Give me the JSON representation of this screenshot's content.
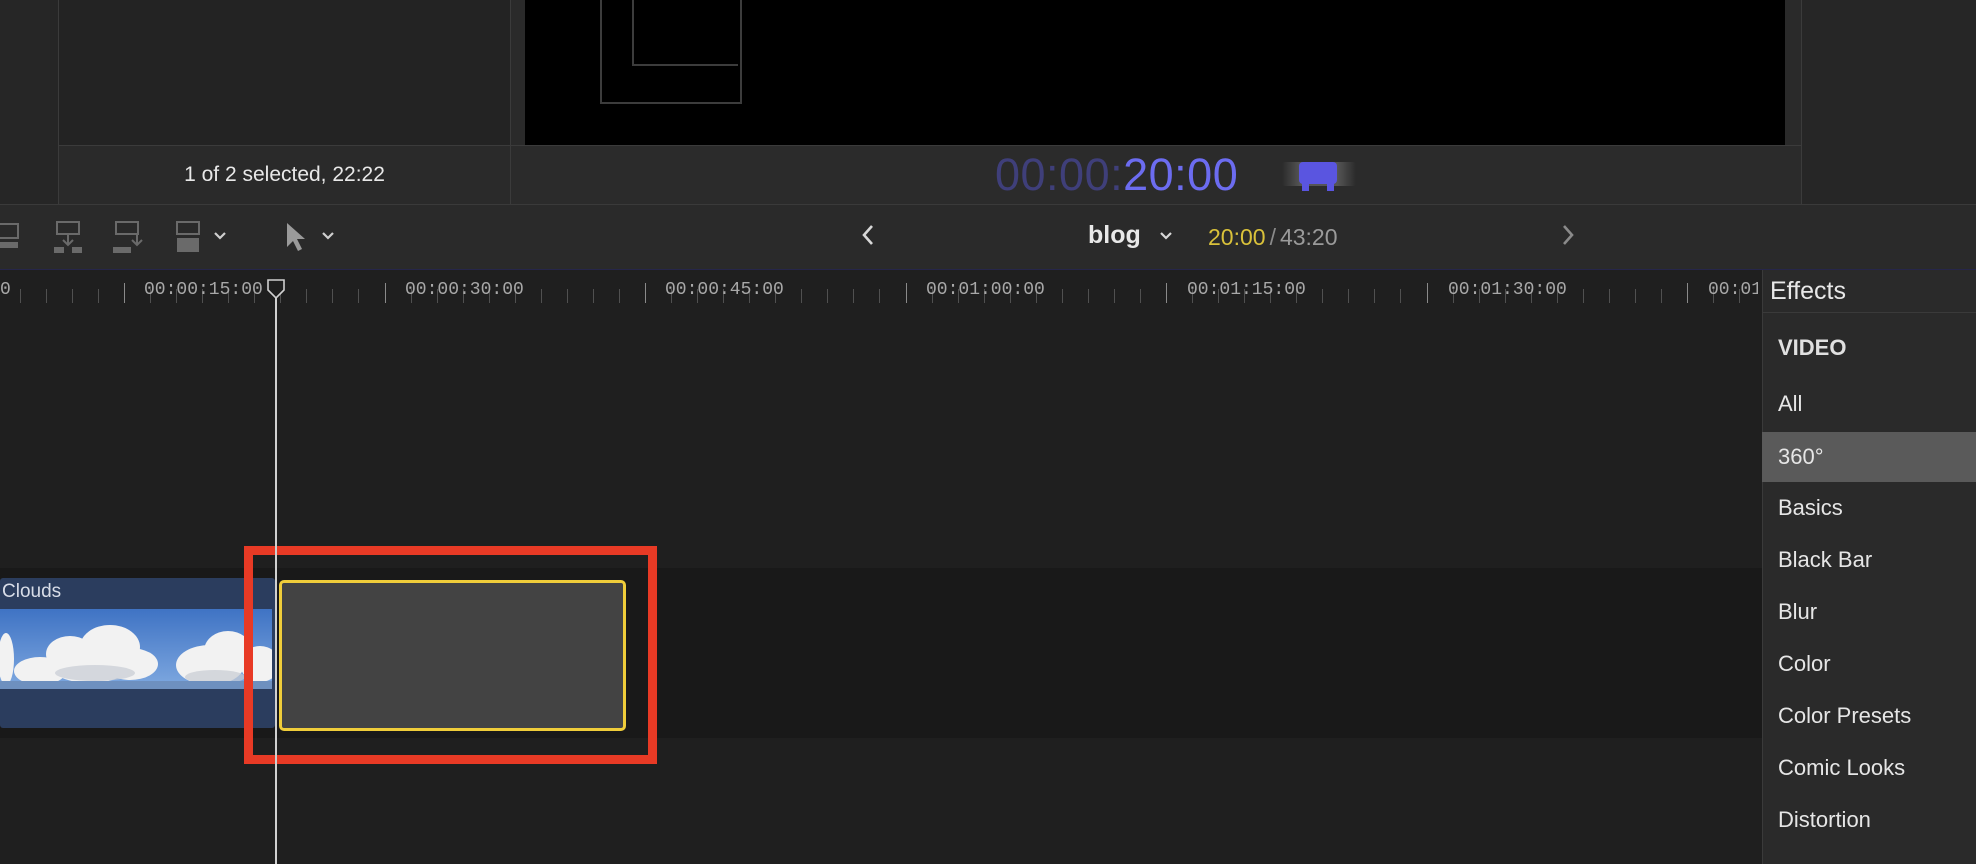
{
  "browser": {
    "status_text": "1 of 2 selected, 22:22"
  },
  "viewer": {
    "timecode_dim": "00:00:",
    "timecode_bright": "20:00"
  },
  "toolbar": {
    "project_name": "blog",
    "duration_current": "20:00",
    "duration_separator": "/",
    "duration_total": "43:20",
    "icons": [
      "connect-clip-icon",
      "insert-clip-icon",
      "append-clip-icon",
      "overwrite-clip-icon",
      "select-tool-arrow-icon",
      "chevron-down-icon",
      "chevron-left-icon",
      "chevron-right-icon"
    ]
  },
  "timeline": {
    "ruler_labels": [
      "0",
      "00:00:15:00",
      "00:00:30:00",
      "00:00:45:00",
      "00:01:00:00",
      "00:01:15:00",
      "00:01:30:00",
      "00:01"
    ],
    "clips": [
      {
        "name": "Clouds"
      },
      {
        "name": ""
      }
    ]
  },
  "effects": {
    "title": "Effects",
    "section": "VIDEO",
    "items": [
      "All",
      "360°",
      "Basics",
      "Black Bar",
      "Blur",
      "Color",
      "Color Presets",
      "Comic Looks",
      "Distortion"
    ],
    "selected": "360°"
  },
  "colors": {
    "timecode_accent": "#6c6cf0",
    "duration_current": "#d9c13a",
    "clip_selected_border": "#f0cd3a",
    "highlight_annotation": "#e83a25",
    "clip_clouds_bg": "#2b3d5e"
  }
}
